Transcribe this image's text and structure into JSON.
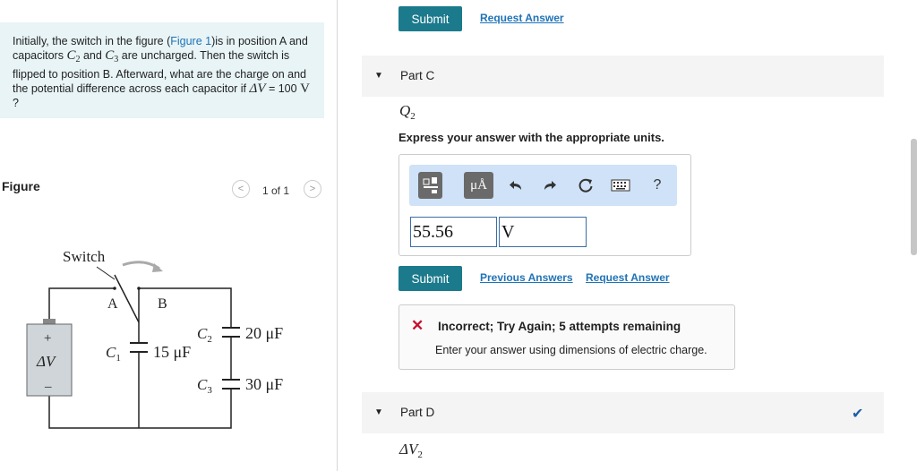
{
  "problem": {
    "text_1": "Initially, the switch in the figure (",
    "figure_link": "Figure 1",
    "text_2": ")is in position A and capacitors ",
    "c2_letter": "C",
    "c2_sub": "2",
    "text_3": " and ",
    "c3_letter": "C",
    "c3_sub": "3",
    "text_4": " are uncharged. Then the switch is flipped to position B. Afterward, what are the charge on and the potential difference across each capacitor if ",
    "delta_v": "ΔV",
    "text_5": " = 100 ",
    "volt": "V",
    "text_6": " ?"
  },
  "figure": {
    "heading": "Figure",
    "pager": "1 of 1",
    "prev_glyph": "<",
    "next_glyph": ">",
    "switch_label": "Switch",
    "pos_a": "A",
    "pos_b": "B",
    "battery_plus": "+",
    "battery_minus": "–",
    "battery_label": "ΔV",
    "c1_letter": "C",
    "c1_sub": "1",
    "c1_value": "15 μF",
    "c2_letter": "C",
    "c2_sub": "2",
    "c2_value": "20 μF",
    "c3_letter": "C",
    "c3_sub": "3",
    "c3_value": "30 μF"
  },
  "top_actions": {
    "submit": "Submit",
    "request_answer": "Request Answer"
  },
  "part_c": {
    "title": "Part C",
    "quantity_letter": "Q",
    "quantity_sub": "2",
    "instruction": "Express your answer with the appropriate units.",
    "toolbar": {
      "units_glyph": "μÅ",
      "help_glyph": "?"
    },
    "value_input": "55.56",
    "unit_input": "V",
    "submit": "Submit",
    "previous_answers": "Previous Answers",
    "request_answer": "Request Answer",
    "feedback_icon": "✕",
    "feedback_title": "Incorrect; Try Again; 5 attempts remaining",
    "feedback_body": "Enter your answer using dimensions of electric charge."
  },
  "part_d": {
    "title": "Part D",
    "check_glyph": "✔",
    "quantity_letter": "ΔV",
    "quantity_sub": "2"
  },
  "colors": {
    "accent": "#1b7a8c",
    "link": "#1f73b7",
    "error": "#c8102e",
    "success": "#1b5fa8",
    "problem_bg": "#e8f4f6"
  }
}
